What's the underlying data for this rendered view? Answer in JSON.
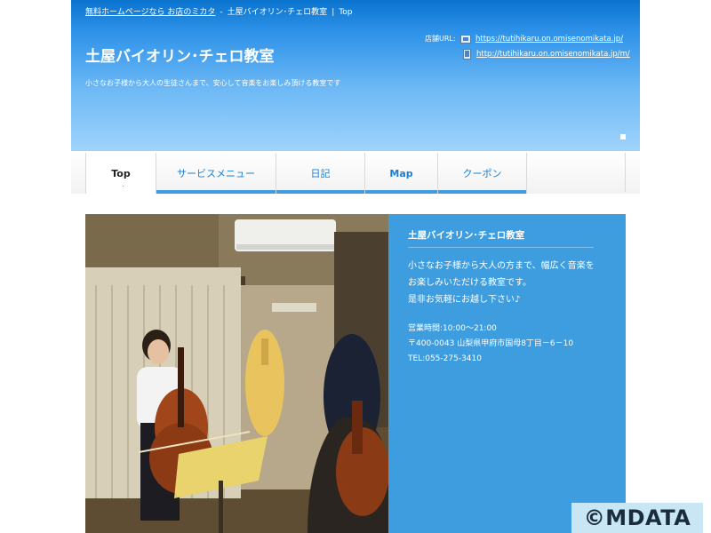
{
  "breadcrumb": {
    "home_link": "無料ホームページなら お店のミカタ",
    "separator": "-",
    "site": "土屋バイオリン･チェロ教室",
    "divider": "|",
    "current": "Top"
  },
  "header": {
    "site_title": "土屋バイオリン･チェロ教室",
    "tagline": "小さなお子様から大人の生徒さんまで、安心して音楽をお楽しみ頂ける教室です",
    "url_label": "店舗URL:",
    "pc_url": "https://tutihikaru.on.omisenomikata.jp/",
    "mobile_url": "http://tutihikaru.on.omisenomikata.jp/m/"
  },
  "nav": {
    "items": [
      {
        "label": "Top"
      },
      {
        "label": "サービスメニュー"
      },
      {
        "label": "日記"
      },
      {
        "label": "Map"
      },
      {
        "label": "クーポン"
      }
    ],
    "active_marker": "˙"
  },
  "info": {
    "title": "土屋バイオリン･チェロ教室",
    "description": [
      "小さなお子様から大人の方まで、幅広く音楽を",
      "お楽しみいただける教室です。",
      "是非お気軽にお越し下さい♪"
    ],
    "hours": "営業時間:10:00～21:00",
    "address": "〒400-0043 山梨県甲府市国母8丁目－6－10",
    "tel": "TEL:055-275-3410"
  },
  "watermark": "©MDATA",
  "colors": {
    "header_top": "#0b74cf",
    "header_bottom": "#9fd3fb",
    "nav_text": "#1c7fd0",
    "nav_bar": "#3f9be2",
    "info_panel": "#3e9ddf"
  },
  "icons": {
    "pc_icon": "computer-icon",
    "mobile_icon": "mobile-phone-icon"
  }
}
